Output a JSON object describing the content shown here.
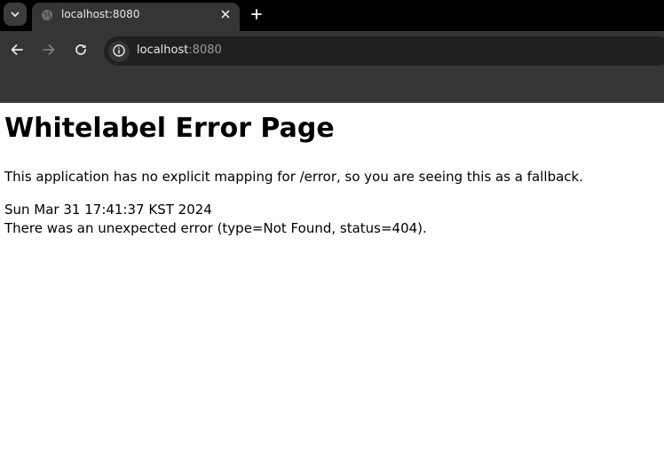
{
  "browser": {
    "tab": {
      "title": "localhost:8080",
      "favicon": "globe-icon"
    },
    "address_bar": {
      "host": "localhost",
      "port": ":8080"
    },
    "icons": {
      "tab_search": "chevron-down-icon",
      "close": "close-icon",
      "new_tab": "plus-icon",
      "back": "arrow-left-icon",
      "forward": "arrow-right-icon",
      "reload": "reload-icon",
      "site_info": "info-icon"
    },
    "colors": {
      "tabstrip_bg": "#000000",
      "toolbar_bg": "#353535",
      "omnibox_bg": "#202020"
    }
  },
  "page": {
    "title": "Whitelabel Error Page",
    "message": "This application has no explicit mapping for /error, so you are seeing this as a fallback.",
    "timestamp": "Sun Mar 31 17:41:37 KST 2024",
    "error": "There was an unexpected error (type=Not Found, status=404)."
  }
}
